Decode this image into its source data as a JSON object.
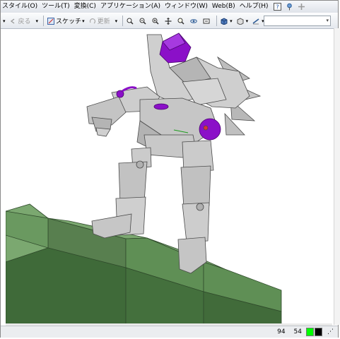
{
  "menubar": {
    "items": [
      "スタイル(O)",
      "ツール(T)",
      "変換(C)",
      "アプリケーション(A)",
      "ウィンドウ(W)",
      "Web(B)",
      "ヘルプ(H)"
    ]
  },
  "toolbar": {
    "back_label": "戻る",
    "sketch_label": "スケッチ",
    "update_label": "更新"
  },
  "status": {
    "value_1": "94",
    "value_2": "54",
    "colors": [
      "#00ff00",
      "#000000"
    ]
  },
  "scene": {
    "robot_color": "#c8c8c8",
    "joint_color": "#8b10c8",
    "stairs_color": "#5f8f55"
  }
}
